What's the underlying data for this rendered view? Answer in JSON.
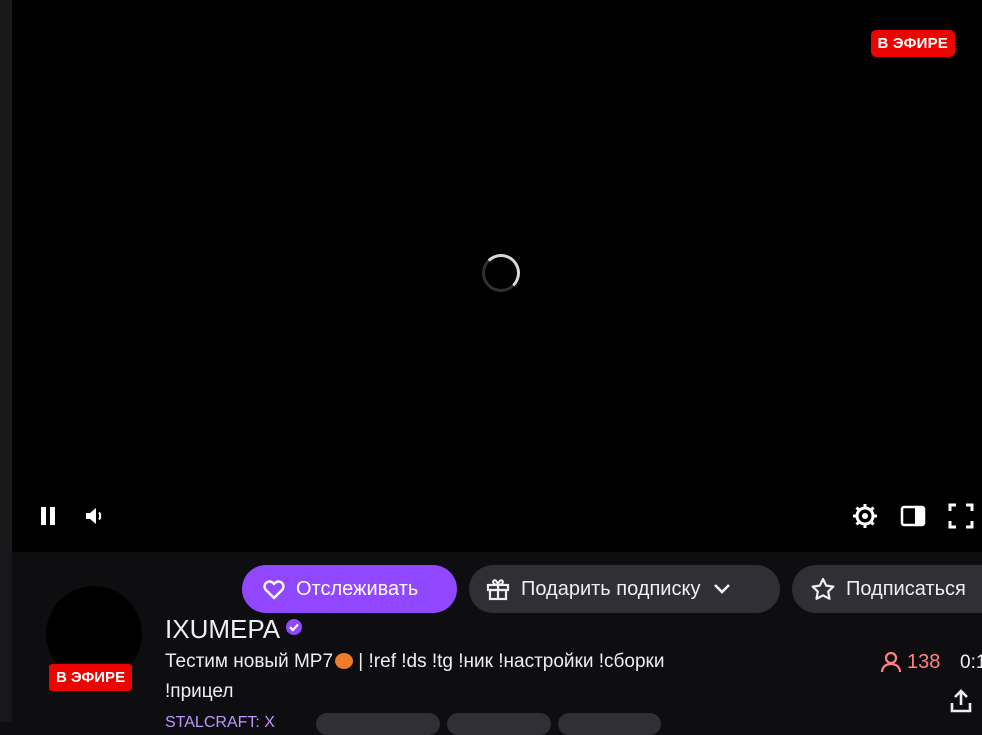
{
  "player": {
    "live_badge": "В ЭФИРЕ",
    "controls": {
      "pause_icon": "pause-icon",
      "volume_icon": "volume-icon",
      "settings_icon": "gear-icon",
      "theatre_icon": "theatre-mode-icon",
      "fullscreen_icon": "fullscreen-icon"
    }
  },
  "channel": {
    "live_badge": "В ЭФИРЕ",
    "name": "IXUMEPA",
    "verified_icon": "verified-badge-icon",
    "title_line1": "Тестим новый MP7",
    "title_line1_rest": " | !ref !ds !tg !ник !настройки !сборки",
    "title_line2": "!прицел",
    "category_partial": "STALCRAFT: X",
    "viewers": "138",
    "uptime_partial": "0:1"
  },
  "actions": {
    "follow_label": "Отслеживать",
    "gift_label": "Подарить подписку",
    "subscribe_label": "Подписаться"
  },
  "colors": {
    "accent": "#9147ff",
    "live": "#eb0400",
    "viewers": "#ff8280",
    "button_bg": "#2f2f35",
    "page_bg": "#0e0e10"
  }
}
